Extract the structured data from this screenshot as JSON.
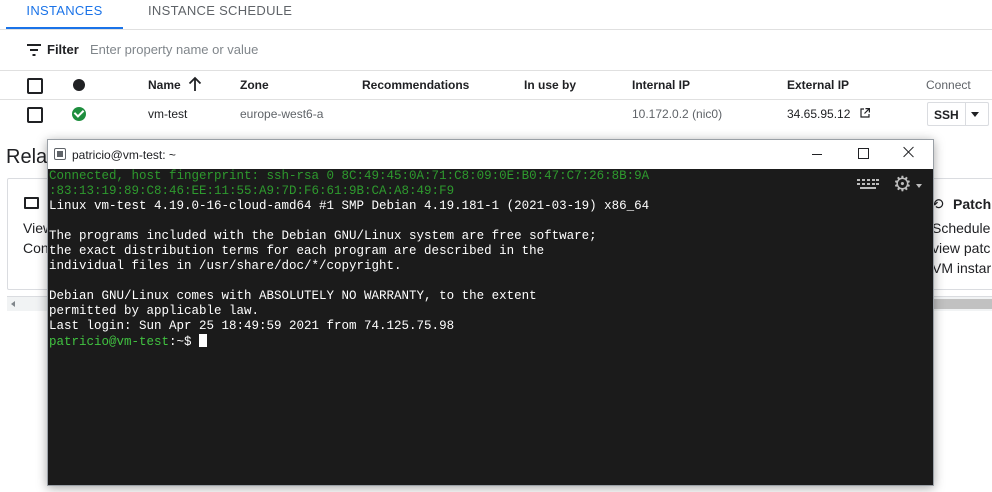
{
  "tabs": [
    {
      "label": "INSTANCES",
      "active": true
    },
    {
      "label": "INSTANCE SCHEDULE",
      "active": false
    }
  ],
  "filter": {
    "label": "Filter",
    "placeholder": "Enter property name or value"
  },
  "table": {
    "headers": {
      "name": "Name",
      "zone": "Zone",
      "recommendations": "Recommendations",
      "in_use_by": "In use by",
      "internal_ip": "Internal IP",
      "external_ip": "External IP",
      "connect": "Connect"
    },
    "rows": [
      {
        "status": "running",
        "name": "vm-test",
        "zone": "europe-west6-a",
        "recommendations": "",
        "in_use_by": "",
        "internal_ip": "10.172.0.2",
        "internal_ip_nic": "(nic0)",
        "external_ip": "34.65.95.12",
        "connect_label": "SSH"
      }
    ]
  },
  "related": {
    "title_partial": "Relat",
    "left_card": {
      "line1": "View",
      "line2": "Con"
    },
    "right_card": {
      "title": "Patch",
      "line1": "Schedule",
      "line2": "view patc",
      "line3": "VM instar"
    }
  },
  "terminal": {
    "title": "patricio@vm-test: ~",
    "lines": [
      {
        "text": "Connected, host fingerprint: ssh-rsa 0 8C:49:45:0A:71:C8:09:0E:B0:47:C7:26:8B:9A",
        "style": "green"
      },
      {
        "text": ":83:13:19:89:C8:46:EE:11:55:A9:7D:F6:61:9B:CA:A8:49:F9",
        "style": "green"
      },
      {
        "text": "Linux vm-test 4.19.0-16-cloud-amd64 #1 SMP Debian 4.19.181-1 (2021-03-19) x86_64",
        "style": "white"
      },
      {
        "text": "",
        "style": "white"
      },
      {
        "text": "The programs included with the Debian GNU/Linux system are free software;",
        "style": "white"
      },
      {
        "text": "the exact distribution terms for each program are described in the",
        "style": "white"
      },
      {
        "text": "individual files in /usr/share/doc/*/copyright.",
        "style": "white"
      },
      {
        "text": "",
        "style": "white"
      },
      {
        "text": "Debian GNU/Linux comes with ABSOLUTELY NO WARRANTY, to the extent",
        "style": "white"
      },
      {
        "text": "permitted by applicable law.",
        "style": "white"
      },
      {
        "text": "Last login: Sun Apr 25 18:49:59 2021 from 74.125.75.98",
        "style": "white"
      }
    ],
    "prompt_user": "patricio@vm-test",
    "prompt_suffix": ":~$ "
  },
  "icons": {
    "filter": "filter-icon",
    "sort": "arrow-up-icon",
    "status": "check-circle-icon",
    "external_link": "open-in-new-icon",
    "keyboard": "keyboard-icon",
    "settings": "gear-icon"
  },
  "colors": {
    "accent": "#1a73e8",
    "status_ok": "#1e8e3e",
    "terminal_bg": "#1b1b1b",
    "terminal_green": "#2e9a2e"
  }
}
